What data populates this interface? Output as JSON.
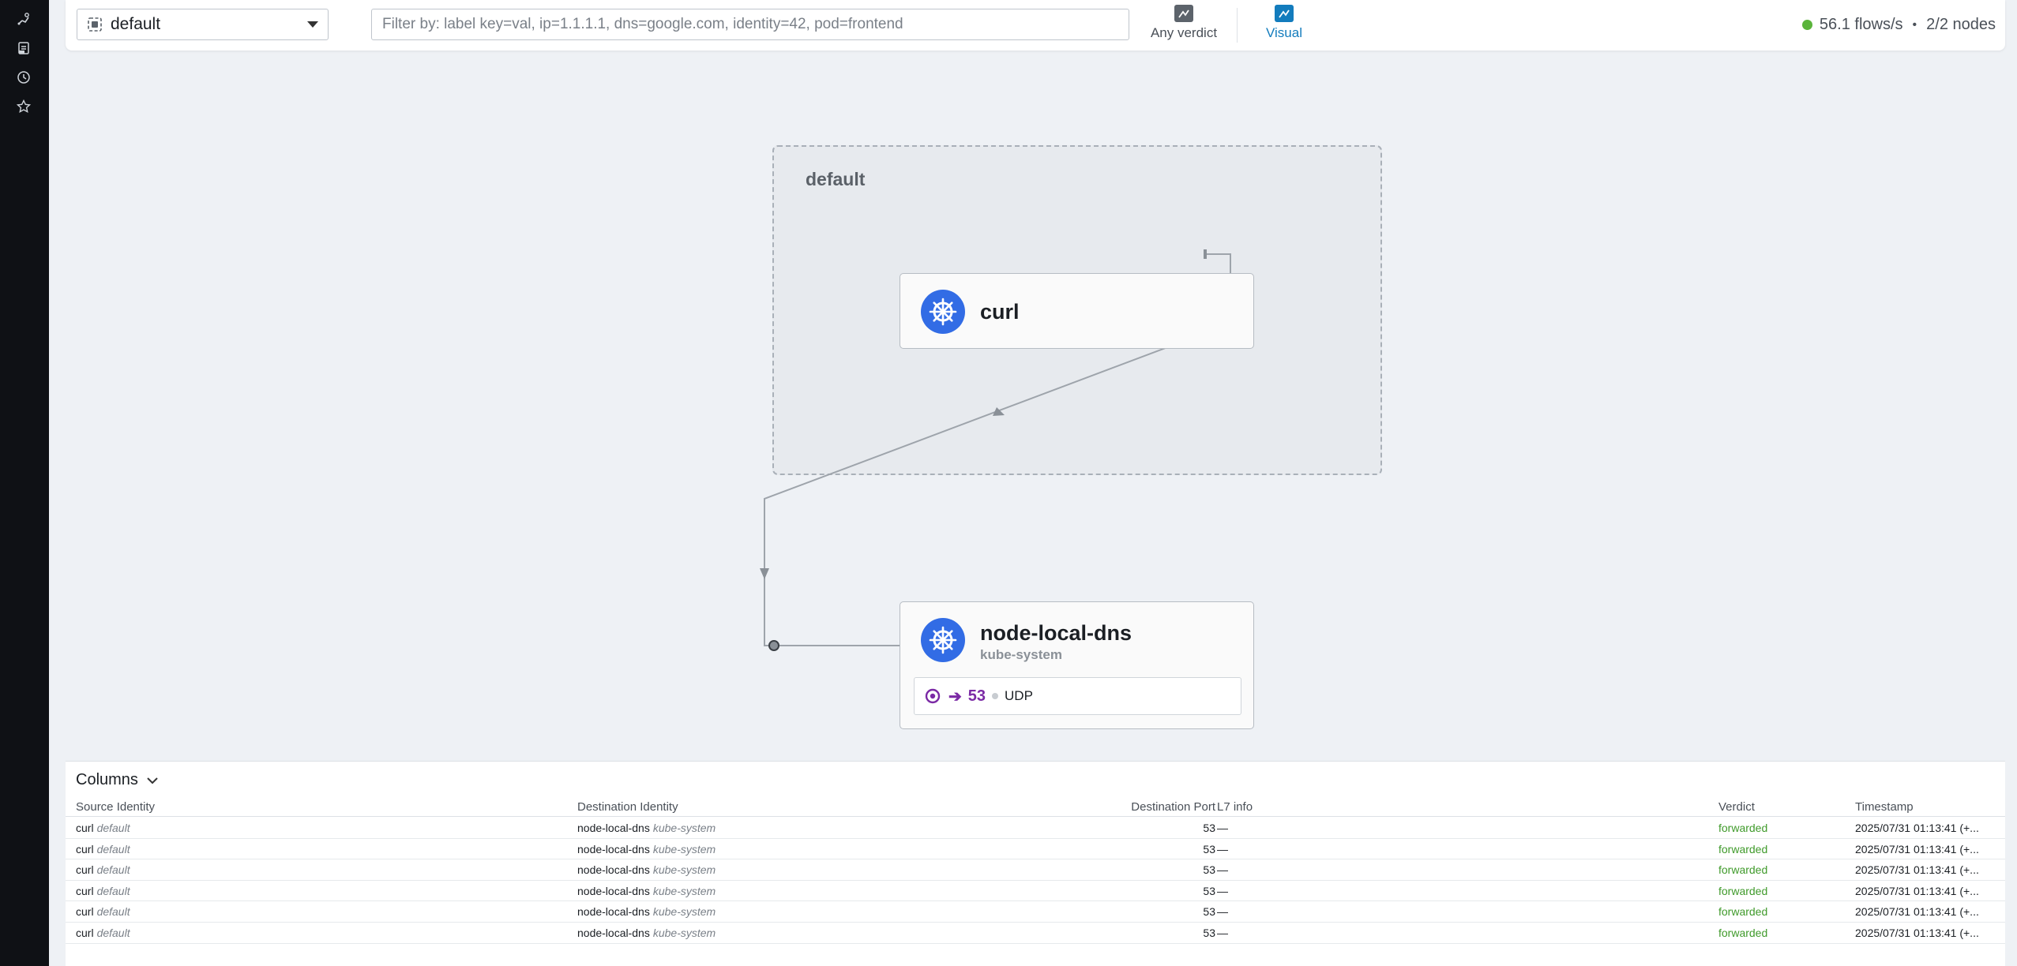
{
  "sidebar": {
    "items": [
      {
        "icon": "service-map-icon"
      },
      {
        "icon": "policies-icon"
      },
      {
        "icon": "history-icon"
      },
      {
        "icon": "star-icon"
      }
    ]
  },
  "toolbar": {
    "namespace_value": "default",
    "filter_placeholder": "Filter by: label key=val, ip=1.1.1.1, dns=google.com, identity=42, pod=frontend",
    "verdict_label": "Any verdict",
    "visual_label": "Visual",
    "flows_rate": "56.1 flows/s",
    "separator": "•",
    "nodes": "2/2 nodes"
  },
  "map": {
    "namespace_title": "default",
    "nodes": [
      {
        "name": "curl",
        "namespace": ""
      },
      {
        "name": "node-local-dns",
        "namespace": "kube-system",
        "port": "53",
        "protocol": "UDP"
      }
    ]
  },
  "table": {
    "columns_label": "Columns",
    "headers": [
      "Source Identity",
      "Destination Identity",
      "Destination Port",
      "L7 info",
      "Verdict",
      "Timestamp"
    ],
    "rows": [
      {
        "src": "curl",
        "src_ns": "default",
        "dst": "node-local-dns",
        "dst_ns": "kube-system",
        "port": "53",
        "l7": "—",
        "verdict": "forwarded",
        "ts": "2025/07/31 01:13:41 (+..."
      },
      {
        "src": "curl",
        "src_ns": "default",
        "dst": "node-local-dns",
        "dst_ns": "kube-system",
        "port": "53",
        "l7": "—",
        "verdict": "forwarded",
        "ts": "2025/07/31 01:13:41 (+..."
      },
      {
        "src": "curl",
        "src_ns": "default",
        "dst": "node-local-dns",
        "dst_ns": "kube-system",
        "port": "53",
        "l7": "—",
        "verdict": "forwarded",
        "ts": "2025/07/31 01:13:41 (+..."
      },
      {
        "src": "curl",
        "src_ns": "default",
        "dst": "node-local-dns",
        "dst_ns": "kube-system",
        "port": "53",
        "l7": "—",
        "verdict": "forwarded",
        "ts": "2025/07/31 01:13:41 (+..."
      },
      {
        "src": "curl",
        "src_ns": "default",
        "dst": "node-local-dns",
        "dst_ns": "kube-system",
        "port": "53",
        "l7": "—",
        "verdict": "forwarded",
        "ts": "2025/07/31 01:13:41 (+..."
      },
      {
        "src": "curl",
        "src_ns": "default",
        "dst": "node-local-dns",
        "dst_ns": "kube-system",
        "port": "53",
        "l7": "—",
        "verdict": "forwarded",
        "ts": "2025/07/31 01:13:41 (+..."
      }
    ]
  },
  "colors": {
    "accent": "#137cbd",
    "k8s_blue": "#326ce5",
    "status_ok": "#5bb43b",
    "port_purple": "#7b2aa5",
    "forwarded": "#3f9a2a"
  }
}
